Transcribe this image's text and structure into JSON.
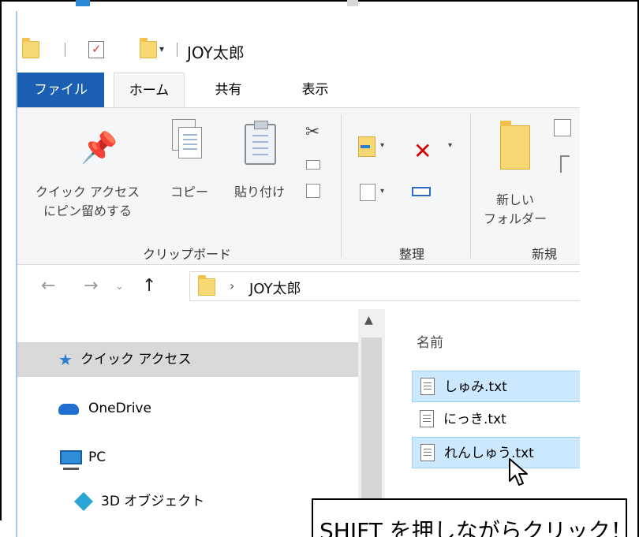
{
  "window": {
    "title": "JOY太郎"
  },
  "ribbon": {
    "tabs": [
      {
        "label": "ファイル"
      },
      {
        "label": "ホーム"
      },
      {
        "label": "共有"
      },
      {
        "label": "表示"
      }
    ],
    "clipboard": {
      "pin_label_1": "クイック アクセス",
      "pin_label_2": "にピン留めする",
      "copy_label": "コピー",
      "paste_label": "貼り付け",
      "group_label": "クリップボード"
    },
    "organize": {
      "group_label": "整理"
    },
    "new": {
      "folder_label_1": "新しい",
      "folder_label_2": "フォルダー",
      "group_label": "新規"
    }
  },
  "address": {
    "path": "JOY太郎"
  },
  "nav": {
    "items": [
      {
        "label": "クイック アクセス",
        "icon": "star-icon",
        "selected": true
      },
      {
        "label": "OneDrive",
        "icon": "cloud-icon",
        "selected": false
      },
      {
        "label": "PC",
        "icon": "computer-icon",
        "selected": false
      },
      {
        "label": "3D オブジェクト",
        "icon": "cube-icon",
        "selected": false
      }
    ]
  },
  "files": {
    "column_header": "名前",
    "items": [
      {
        "name": "しゅみ.txt",
        "selected": true
      },
      {
        "name": "にっき.txt",
        "selected": false
      },
      {
        "name": "れんしゅう.txt",
        "selected": true
      }
    ]
  },
  "callout": {
    "text": "SHIFT を押しながらクリック！"
  },
  "colors": {
    "file_tab": "#1a5fb4",
    "selection": "#cce8ff",
    "folder": "#f8d775",
    "delete": "#d20000"
  }
}
